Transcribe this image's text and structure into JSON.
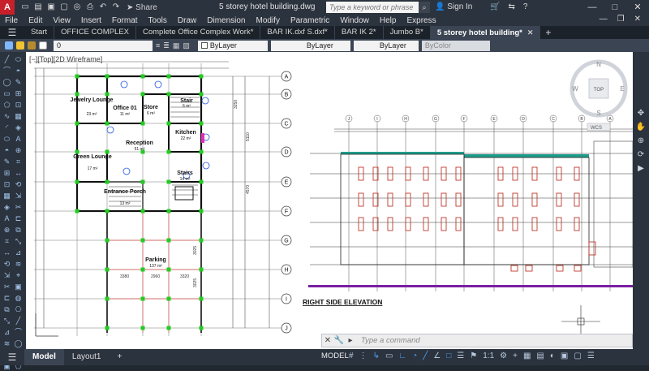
{
  "app": {
    "logo": "A",
    "doc_title": "5 storey hotel building.dwg",
    "share_label": "Share",
    "search_placeholder": "Type a keyword or phrase",
    "signin_label": "Sign In"
  },
  "menu": [
    "File",
    "Edit",
    "View",
    "Insert",
    "Format",
    "Tools",
    "Draw",
    "Dimension",
    "Modify",
    "Parametric",
    "Window",
    "Help",
    "Express"
  ],
  "tabs": [
    {
      "label": "Start",
      "active": false
    },
    {
      "label": "OFFICE COMPLEX",
      "active": false
    },
    {
      "label": "Complete Office Complex Work*",
      "active": false
    },
    {
      "label": "BAR IK.dxf S.dxf*",
      "active": false
    },
    {
      "label": "BAR IK 2*",
      "active": false
    },
    {
      "label": "Jumbo B*",
      "active": false
    },
    {
      "label": "5 storey hotel building*",
      "active": true
    }
  ],
  "properties": {
    "layer": "0",
    "color": "ByLayer",
    "linetype": "ByLayer",
    "lineweight": "ByLayer",
    "plotstyle": "ByColor"
  },
  "view_label": "[−][Top][2D Wireframe]",
  "viewcube": {
    "top": "TOP",
    "n": "N",
    "s": "S",
    "e": "E",
    "w": "W",
    "wcs": "WCS"
  },
  "plan": {
    "rooms": [
      {
        "name": "Jewelry Lounge",
        "area": "23 m²"
      },
      {
        "name": "Office 01",
        "area": "11 m²"
      },
      {
        "name": "Store",
        "area": "6 m²"
      },
      {
        "name": "Stair",
        "area": "6 m²"
      },
      {
        "name": "Kitchen",
        "area": "22 m²"
      },
      {
        "name": "Reception",
        "area": "51 m²"
      },
      {
        "name": "Green Lounge",
        "area": "17 m²"
      },
      {
        "name": "Stairs",
        "area": "14 m²"
      },
      {
        "name": "Entrance Porch",
        "area": "13 m²"
      },
      {
        "name": "Parking",
        "area": "137 m²"
      }
    ],
    "grid_rows": [
      "A",
      "B",
      "C",
      "D",
      "E",
      "F",
      "G",
      "H",
      "I",
      "J"
    ],
    "dims_right": [
      "3250",
      "5110",
      "4570",
      "3025",
      "3025"
    ],
    "dims_bottom": [
      "3380",
      "2960",
      "3320"
    ]
  },
  "elevation": {
    "title": "RIGHT SIDE ELEVATION",
    "grid_cols": [
      "J",
      "I",
      "H",
      "G",
      "F",
      "E",
      "D",
      "C",
      "B",
      "A"
    ]
  },
  "command": {
    "placeholder": "Type a command"
  },
  "status": {
    "tabs": [
      {
        "label": "Model",
        "active": true
      },
      {
        "label": "Layout1",
        "active": false
      }
    ],
    "model_button": "MODEL",
    "scale": "1:1"
  }
}
